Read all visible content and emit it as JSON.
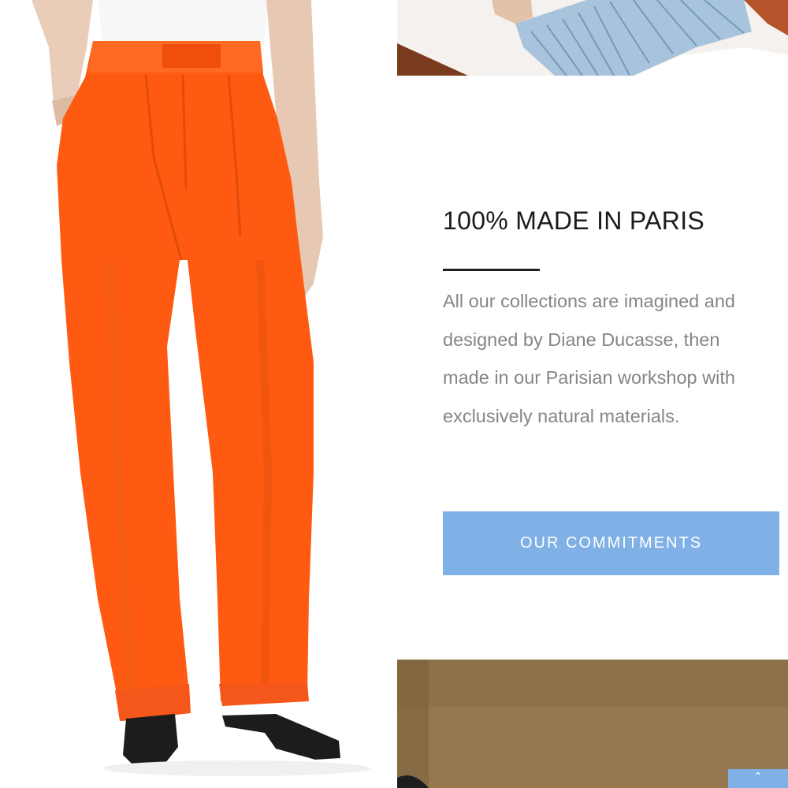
{
  "commitments": {
    "heading": "100% MADE IN PARIS",
    "body": "All our collections are imagined and designed by Diane Ducasse, then made in our Parisian workshop with exclusively natural materials.",
    "cta_label": "OUR COMMITMENTS"
  },
  "colors": {
    "accent_button": "#7fb0e6",
    "product_orange": "#ff5a12",
    "heading_text": "#1b1b1b",
    "body_text": "#858585"
  },
  "icons": {
    "scroll_top": "chevron-up-icon"
  }
}
